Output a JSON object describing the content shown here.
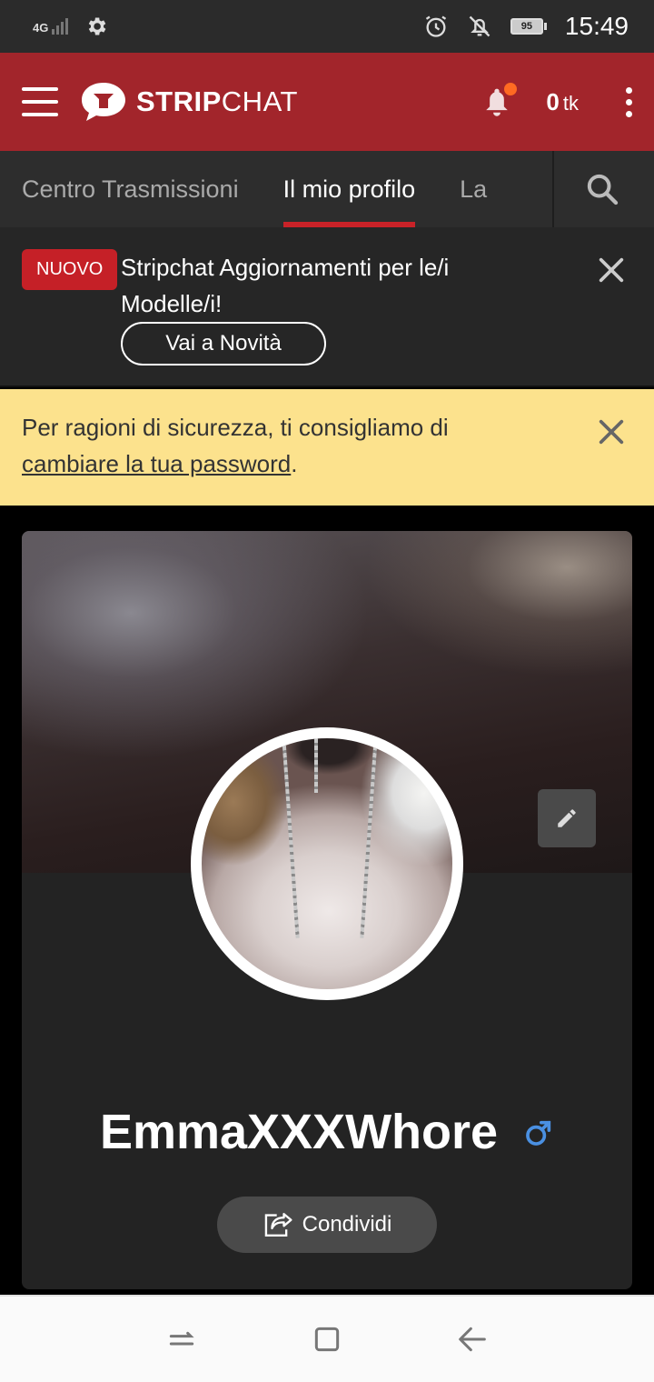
{
  "status_bar": {
    "network": "4G",
    "battery": "95",
    "time": "15:49",
    "icons": [
      "settings-icon",
      "alarm-icon",
      "notifications-off-icon",
      "battery-icon"
    ]
  },
  "header": {
    "logo_bold": "STRIP",
    "logo_light": "CHAT",
    "tokens_value": "0",
    "tokens_unit": "tk",
    "brand_color": "#a2252b",
    "notification_dot_color": "#ff6a22"
  },
  "tabs": [
    {
      "label": "Centro Trasmissioni",
      "active": false
    },
    {
      "label": "Il mio profilo",
      "active": true
    },
    {
      "label": "La",
      "active": false
    }
  ],
  "news_banner": {
    "badge": "NUOVO",
    "text": "Stripchat Aggiornamenti per le/i Modelle/i!",
    "button": "Vai a Novità"
  },
  "warning_banner": {
    "text_before": "Per ragioni di sicurezza, ti consigliamo di ",
    "link": "cambiare la tua password",
    "text_after": ".",
    "background": "#fce28d"
  },
  "profile": {
    "username": "EmmaXXXWhore",
    "gender_icon": "male-symbol-icon",
    "gender_color": "#4a90e2",
    "share_label": "Condividi"
  }
}
